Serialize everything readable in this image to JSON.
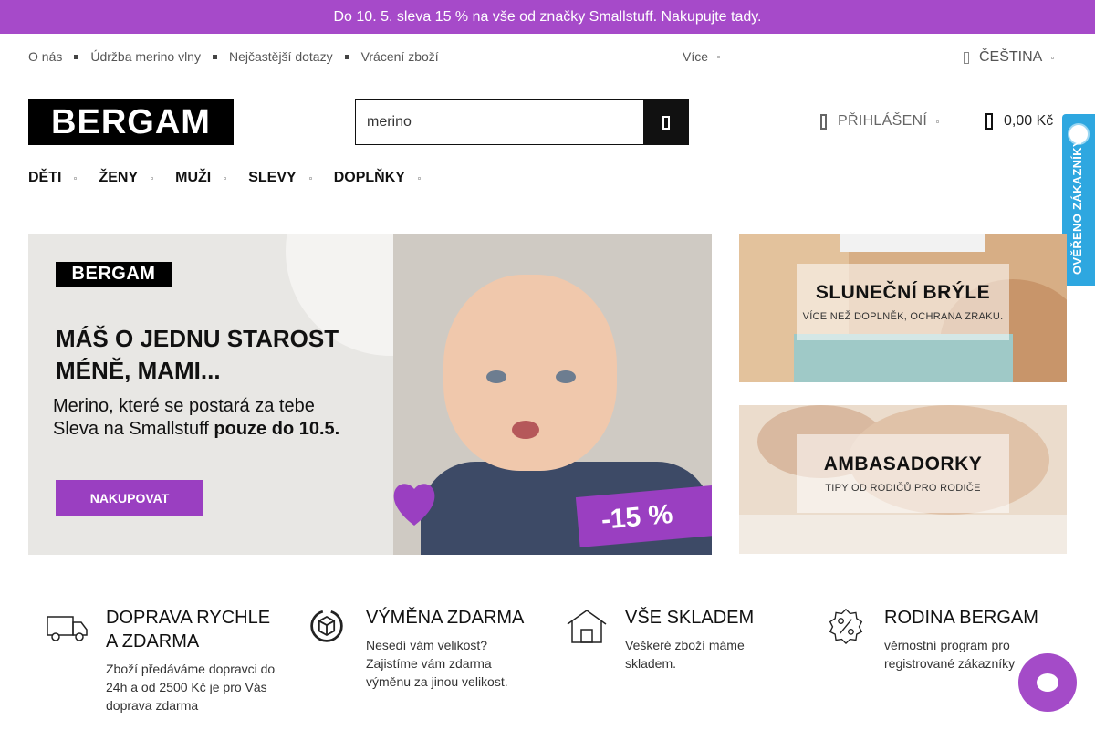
{
  "promo": {
    "text": "Do 10. 5. sleva 15 % na vše od značky Smallstuff. Nakupujte tady."
  },
  "toplinks": [
    "O nás",
    "Údržba merino vlny",
    "Nejčastější dotazy",
    "Vrácení zboží"
  ],
  "more_label": "Více",
  "language_label": "ČEŠTINA",
  "logo_text": "BERGAM",
  "search": {
    "value": "merino"
  },
  "account_label": "PŘIHLÁŠENÍ",
  "cart_total": "0,00 Kč",
  "verified_label": "OVĚŘENO ZÁKAZNÍKY",
  "nav": [
    "DĚTI",
    "ŽENY",
    "MUŽI",
    "SLEVY",
    "DOPLŇKY"
  ],
  "hero": {
    "brand": "BERGAM",
    "headline_1": "MÁŠ O JEDNU STAROST",
    "headline_2": "MÉNĚ, MAMI...",
    "sub_1": "Merino, které se postará za tebe",
    "sub_2_prefix": "Sleva na Smallstuff ",
    "sub_2_bold": "pouze do 10.5.",
    "cta": "NAKUPOVAT",
    "discount": "-15 %"
  },
  "banners": [
    {
      "title": "SLUNEČNÍ BRÝLE",
      "subtitle": "VÍCE NEŽ DOPLNĚK, OCHRANA ZRAKU."
    },
    {
      "title": "AMBASADORKY",
      "subtitle": "TIPY OD RODIČŮ PRO RODIČE"
    }
  ],
  "features": [
    {
      "icon": "truck-icon",
      "title_1": "DOPRAVA RYCHLE",
      "title_2": "A ZDARMA",
      "desc_1": "Zboží předáváme dopravci do",
      "desc_2": "24h a od 2500 Kč je pro Vás",
      "desc_3": "doprava zdarma"
    },
    {
      "icon": "exchange-box-icon",
      "title_1": "VÝMĚNA ZDARMA",
      "title_2": "",
      "desc_1": "Nesedí vám velikost?",
      "desc_2": "Zajistíme vám zdarma",
      "desc_3": "výměnu za jinou velikost."
    },
    {
      "icon": "warehouse-icon",
      "title_1": "VŠE SKLADEM",
      "title_2": "",
      "desc_1": "Veškeré zboží máme",
      "desc_2": "skladem.",
      "desc_3": ""
    },
    {
      "icon": "discount-badge-icon",
      "title_1": "RODINA BERGAM",
      "title_2": "",
      "desc_1": "věrnostní program pro",
      "desc_2": "registrované zákazníky",
      "desc_3": ""
    }
  ],
  "colors": {
    "accent": "#a64ac9",
    "verified": "#2ea7e0",
    "black": "#111111"
  }
}
